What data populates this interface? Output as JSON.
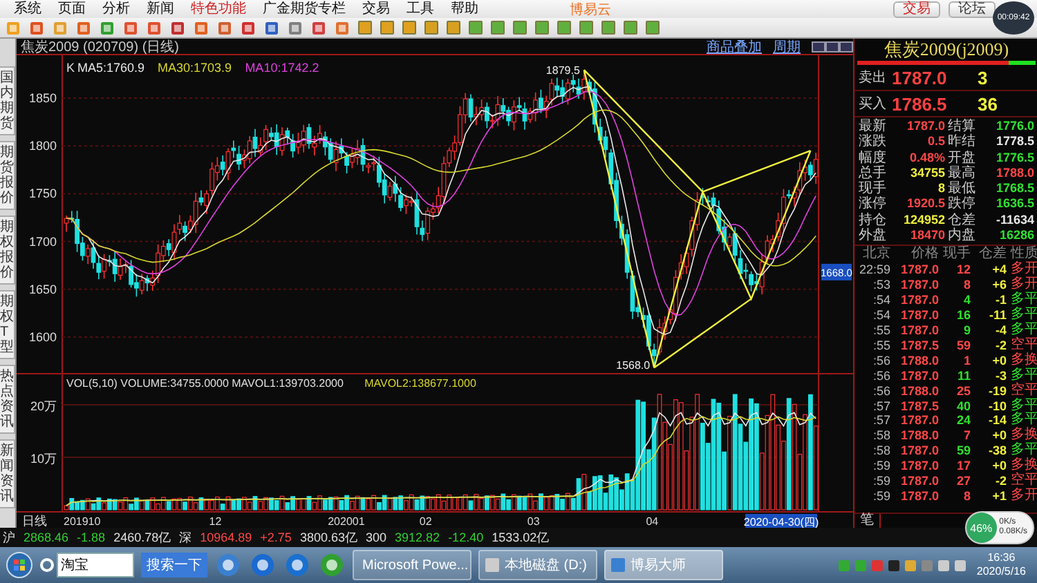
{
  "menu": {
    "items": [
      {
        "label": "系统",
        "highlighted": false
      },
      {
        "label": "页面",
        "highlighted": false
      },
      {
        "label": "分析",
        "highlighted": false
      },
      {
        "label": "新闻",
        "highlighted": false
      },
      {
        "label": "特色功能",
        "highlighted": true
      },
      {
        "label": "广金期货专栏",
        "highlighted": false
      },
      {
        "label": "交易",
        "highlighted": false
      },
      {
        "label": "工具",
        "highlighted": false
      },
      {
        "label": "帮助",
        "highlighted": false
      }
    ],
    "brand": "博易云",
    "buttons": [
      "交易",
      "论坛"
    ],
    "timer": "00:09:42"
  },
  "sidebar": {
    "tabs": [
      "国内期货",
      "期货报价",
      "期权报价",
      "期权T型",
      "热点资讯",
      "新闻资讯"
    ]
  },
  "chart": {
    "title": "焦炭2009 (020709) (日线)",
    "links": [
      "商品叠加",
      "周期"
    ],
    "prefix": "K",
    "legend": [
      {
        "text": "MA5:1760.9",
        "color": "#e8e8e8"
      },
      {
        "text": "MA30:1703.9",
        "color": "#d8d830"
      },
      {
        "text": "MA10:1742.2",
        "color": "#e040e0"
      }
    ],
    "price_ticks": [
      "1850",
      "1800",
      "1750",
      "1700",
      "1650",
      "1600"
    ],
    "high_label": "1879.5",
    "low_label": "1568.0",
    "cursor_price": "1668.0",
    "volume_legend": [
      {
        "text": "VOL(5,10) VOLUME:34755.0000 MAVOL1:139703.2000",
        "color": "#e0e0e0"
      },
      {
        "text": "MAVOL2:138677.1000",
        "color": "#d8d830"
      }
    ],
    "volume_ticks": [
      "20万",
      "10万"
    ],
    "period_label": "日线",
    "date_ticks": [
      "201910",
      "12",
      "202001",
      "02",
      "03",
      "04"
    ],
    "cursor_date": "2020-04-30(四)"
  },
  "quote": {
    "title": "焦炭2009(j2009)",
    "orders": [
      {
        "label": "卖出",
        "price": "1787.0",
        "volume": "3"
      },
      {
        "label": "买入",
        "price": "1786.5",
        "volume": "36"
      }
    ],
    "stats": [
      {
        "label": "最新",
        "value": "1787.0",
        "color": "#ff4848"
      },
      {
        "label": "结算",
        "value": "1776.0",
        "color": "#30e030"
      },
      {
        "label": "涨跌",
        "value": "0.5",
        "color": "#ff4848"
      },
      {
        "label": "昨结",
        "value": "1778.5",
        "color": "#e8e8e8"
      },
      {
        "label": "幅度",
        "value": "0.48%",
        "color": "#ff4848"
      },
      {
        "label": "开盘",
        "value": "1776.5",
        "color": "#30e030"
      },
      {
        "label": "总手",
        "value": "34755",
        "color": "#f0f040"
      },
      {
        "label": "最高",
        "value": "1788.0",
        "color": "#ff4848"
      },
      {
        "label": "现手",
        "value": "8",
        "color": "#f0f040"
      },
      {
        "label": "最低",
        "value": "1768.5",
        "color": "#30e030"
      },
      {
        "label": "涨停",
        "value": "1920.5",
        "color": "#ff4848"
      },
      {
        "label": "跌停",
        "value": "1636.5",
        "color": "#30e030"
      },
      {
        "label": "持仓",
        "value": "124952",
        "color": "#f0f040"
      },
      {
        "label": "仓差",
        "value": "-11634",
        "color": "#e8e8e8"
      },
      {
        "label": "外盘",
        "value": "18470",
        "color": "#ff4848"
      },
      {
        "label": "内盘",
        "value": "16286",
        "color": "#30e030"
      }
    ],
    "tick_columns": [
      "北京",
      "价格",
      "现手",
      "仓差",
      "性质"
    ],
    "ticks": [
      {
        "time": "22:59",
        "price": "1787.0",
        "hand": "12",
        "diff": "+4",
        "type": "多开",
        "kind": "rise"
      },
      {
        "time": ":53",
        "price": "1787.0",
        "hand": "8",
        "diff": "+6",
        "type": "多开",
        "kind": "rise"
      },
      {
        "time": ":54",
        "price": "1787.0",
        "hand": "4",
        "diff": "-1",
        "type": "多平",
        "kind": "fall"
      },
      {
        "time": ":54",
        "price": "1787.0",
        "hand": "16",
        "diff": "-11",
        "type": "多平",
        "kind": "fall"
      },
      {
        "time": ":55",
        "price": "1787.0",
        "hand": "9",
        "diff": "-4",
        "type": "多平",
        "kind": "fall"
      },
      {
        "time": ":55",
        "price": "1787.5",
        "hand": "59",
        "diff": "-2",
        "type": "空平",
        "kind": "rise"
      },
      {
        "time": ":56",
        "price": "1788.0",
        "hand": "1",
        "diff": "+0",
        "type": "多换",
        "kind": "rise"
      },
      {
        "time": ":56",
        "price": "1787.0",
        "hand": "11",
        "diff": "-3",
        "type": "多平",
        "kind": "fall"
      },
      {
        "time": ":56",
        "price": "1788.0",
        "hand": "25",
        "diff": "-19",
        "type": "空平",
        "kind": "rise"
      },
      {
        "time": ":57",
        "price": "1787.5",
        "hand": "40",
        "diff": "-10",
        "type": "多平",
        "kind": "fall"
      },
      {
        "time": ":57",
        "price": "1787.0",
        "hand": "24",
        "diff": "-14",
        "type": "多平",
        "kind": "fall"
      },
      {
        "time": ":58",
        "price": "1788.0",
        "hand": "7",
        "diff": "+0",
        "type": "多换",
        "kind": "rise"
      },
      {
        "time": ":58",
        "price": "1787.0",
        "hand": "59",
        "diff": "-38",
        "type": "多平",
        "kind": "fall"
      },
      {
        "time": ":59",
        "price": "1787.0",
        "hand": "17",
        "diff": "+0",
        "type": "多换",
        "kind": "rise"
      },
      {
        "time": ":59",
        "price": "1787.0",
        "hand": "27",
        "diff": "-2",
        "type": "空平",
        "kind": "rise"
      },
      {
        "time": ":59",
        "price": "1787.0",
        "hand": "8",
        "diff": "+1",
        "type": "多开",
        "kind": "rise"
      }
    ],
    "footer_tab": "笔"
  },
  "index_bar": [
    {
      "text": "沪",
      "color": "#e0e0e0"
    },
    {
      "text": "2868.46",
      "color": "#30d030"
    },
    {
      "text": "-1.88",
      "color": "#30d030"
    },
    {
      "text": "2460.78亿",
      "color": "#e0e0e0"
    },
    {
      "text": "深",
      "color": "#e0e0e0"
    },
    {
      "text": "10964.89",
      "color": "#ff4848"
    },
    {
      "text": "+2.75",
      "color": "#ff4848"
    },
    {
      "text": "3800.63亿",
      "color": "#e0e0e0"
    },
    {
      "text": "300",
      "color": "#e0e0e0"
    },
    {
      "text": "3912.82",
      "color": "#30d030"
    },
    {
      "text": "-12.40",
      "color": "#30d030"
    },
    {
      "text": "1533.02亿",
      "color": "#e0e0e0"
    }
  ],
  "network": {
    "percent": "46%",
    "up": "0K/s",
    "down": "0.08K/s"
  },
  "taskbar": {
    "search_value": "淘宝",
    "search_button": "搜索一下",
    "tasks": [
      {
        "label": "Microsoft Powe...",
        "selected": false
      },
      {
        "label": "本地磁盘 (D:)",
        "selected": false
      },
      {
        "label": "博易大师",
        "selected": true
      }
    ],
    "time": "16:36",
    "date": "2020/5/16"
  }
}
